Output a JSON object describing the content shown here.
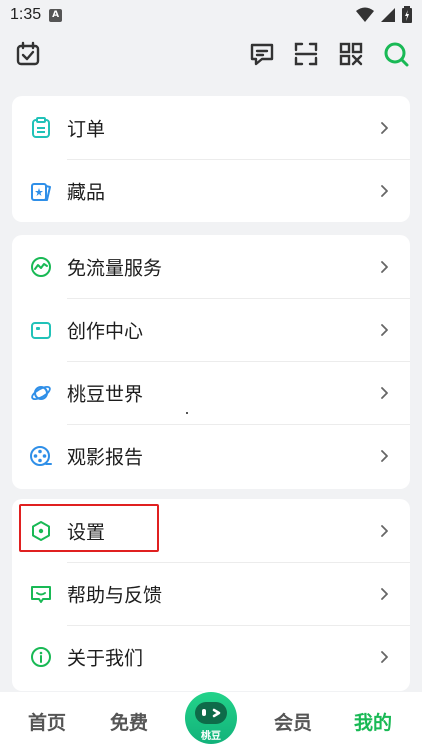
{
  "status": {
    "time": "1:35",
    "badge": "A"
  },
  "groups": [
    {
      "items": [
        {
          "label": "订单",
          "icon": "order-icon"
        },
        {
          "label": "藏品",
          "icon": "collection-icon"
        }
      ]
    },
    {
      "items": [
        {
          "label": "免流量服务",
          "icon": "free-data-icon"
        },
        {
          "label": "创作中心",
          "icon": "creator-icon"
        },
        {
          "label": "桃豆世界",
          "icon": "planet-icon"
        },
        {
          "label": "观影报告",
          "icon": "film-report-icon"
        }
      ]
    },
    {
      "items": [
        {
          "label": "设置",
          "icon": "settings-icon"
        },
        {
          "label": "帮助与反馈",
          "icon": "help-feedback-icon"
        },
        {
          "label": "关于我们",
          "icon": "info-icon"
        }
      ]
    }
  ],
  "tabs": {
    "home": "首页",
    "free": "免费",
    "center": "桃豆",
    "vip": "会员",
    "mine": "我的"
  },
  "colors": {
    "accent": "#19b955",
    "highlight": "#e02020"
  }
}
